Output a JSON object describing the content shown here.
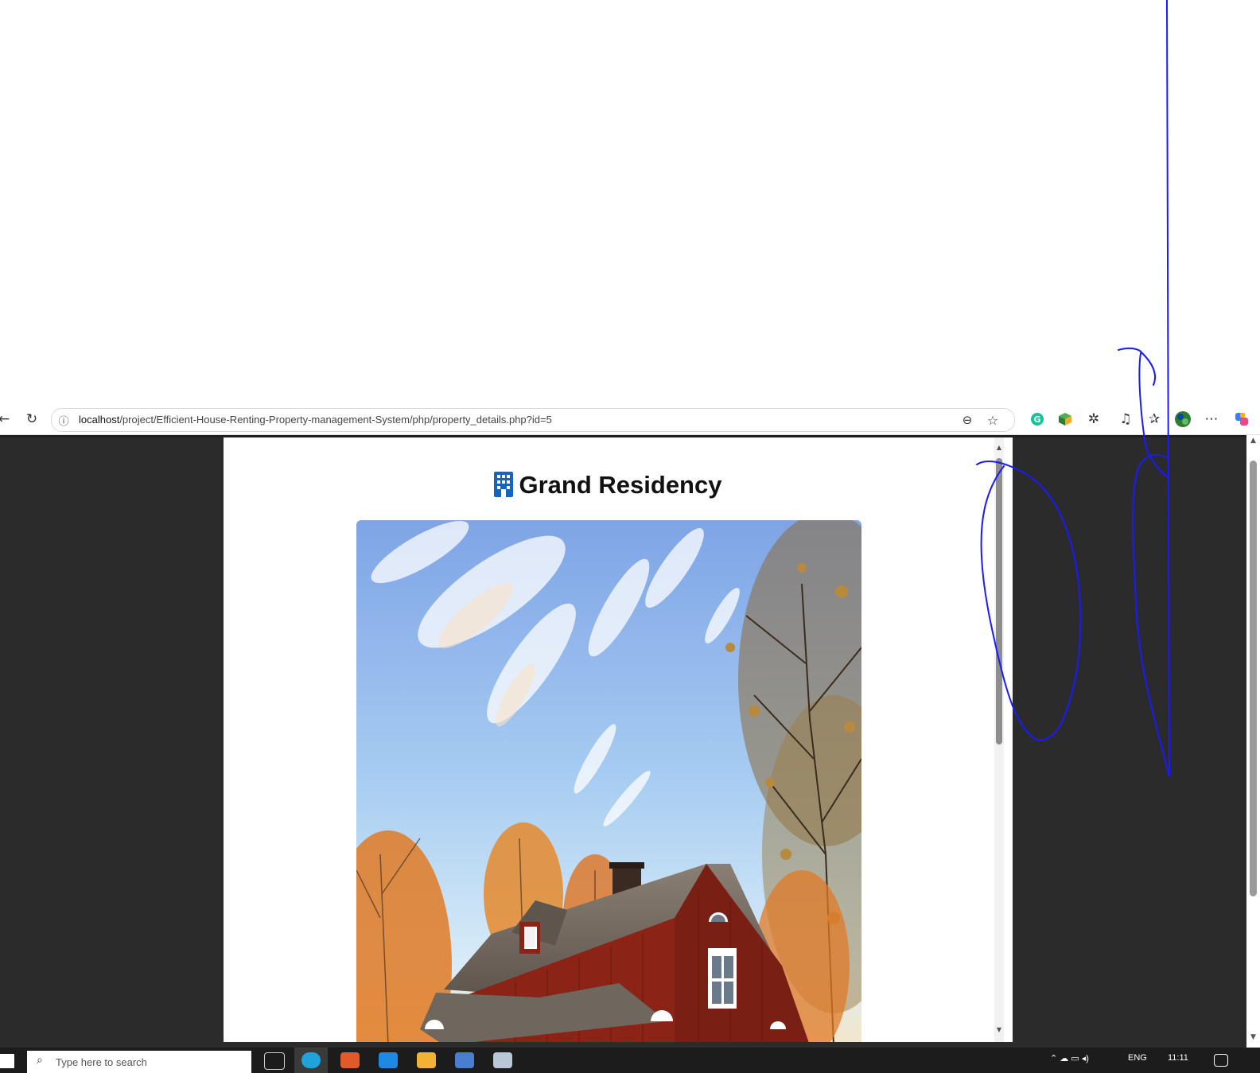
{
  "browser": {
    "url_host": "localhost",
    "url_path": "/project/Efficient-House-Renting-Property-management-System/php/property_details.php?id=5"
  },
  "page": {
    "title": "Grand Residency",
    "title_icon": "building-icon"
  },
  "taskbar": {
    "search_placeholder": "Type here to search",
    "language": "ENG",
    "time": "11:11"
  },
  "annotations": {
    "ink_color": "#1a1aff"
  },
  "colors": {
    "viewport_bg": "#2b2b2b",
    "icon_blue": "#1565c0"
  }
}
